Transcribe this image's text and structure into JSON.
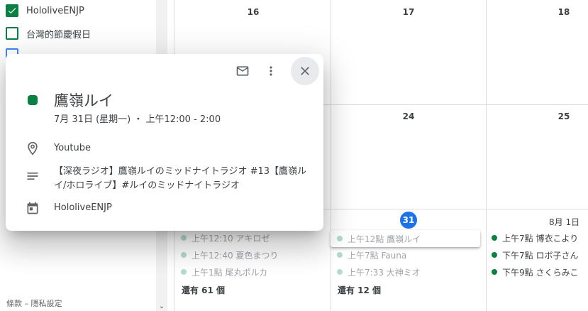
{
  "sidebar": {
    "calendars": [
      {
        "label": "HololiveENJP",
        "checked": true,
        "color": "#0b8043"
      },
      {
        "label": "台灣的節慶假日",
        "checked": false,
        "color": "#0b8043"
      },
      {
        "label": "",
        "checked": false,
        "color": "#4285f4"
      }
    ],
    "footer": "條款 – 隱私設定"
  },
  "calendar": {
    "week1": {
      "days": [
        "16",
        "17",
        "18"
      ]
    },
    "week2": {
      "days": [
        "24",
        "25"
      ]
    },
    "week3": {
      "today": "31",
      "next": "8月 1日",
      "col1_events": [
        {
          "text": "上午12:10 アキロゼ",
          "state": "past"
        },
        {
          "text": "上午12:40 夏色まつり",
          "state": "past"
        },
        {
          "text": "上午1點 尾丸ポルカ",
          "state": "past"
        }
      ],
      "col1_more": "還有 61 個",
      "col2_events": [
        {
          "text": "上午12點 鷹嶺ルイ",
          "state": "past"
        },
        {
          "text": "上午7點 Fauna",
          "state": "past"
        },
        {
          "text": "上午7:33 大神ミオ",
          "state": "past"
        }
      ],
      "col2_more": "還有 12 個",
      "col3_events": [
        {
          "text": "上午7點 博衣こより",
          "state": "future"
        },
        {
          "text": "下午7點 ロボ子さん",
          "state": "future"
        },
        {
          "text": "下午9點 さくらみこ",
          "state": "future"
        }
      ]
    }
  },
  "popup": {
    "title": "鷹嶺ルイ",
    "datetime": "7月 31日 (星期一) ・ 上午12:00 - 2:00",
    "location": "Youtube",
    "description": "【深夜ラジオ】鷹嶺ルイのミッドナイトラジオ #13【鷹嶺ルイ/ホロライブ】#ルイのミッドナイトラジオ",
    "calendar": "HololiveENJP",
    "color": "#0b8043",
    "icons": [
      "email-icon",
      "more-vert-icon",
      "close-icon",
      "location-icon",
      "description-icon",
      "calendar-icon"
    ]
  }
}
